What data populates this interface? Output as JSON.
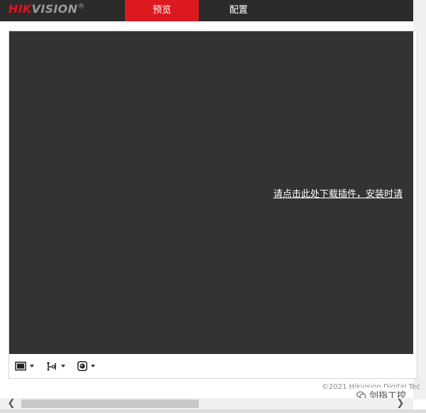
{
  "header": {
    "logo_brand": "HIK",
    "logo_rest": "VISION",
    "logo_mark": "®",
    "tabs": [
      {
        "label": "预览",
        "active": true
      },
      {
        "label": "配置",
        "active": false
      }
    ],
    "accent_color": "#dd1920"
  },
  "video": {
    "plugin_message": "请点击此处下载插件，安装时请"
  },
  "toolbar": {
    "icons": [
      "window-layout-icon",
      "stream-type-icon",
      "capture-icon"
    ]
  },
  "footer": {
    "copyright": "©2021 Hikvision Digital Tec",
    "watermark": "剑指工控"
  },
  "scrollbar": {
    "left_arrow": "❮",
    "right_arrow": "❯"
  }
}
